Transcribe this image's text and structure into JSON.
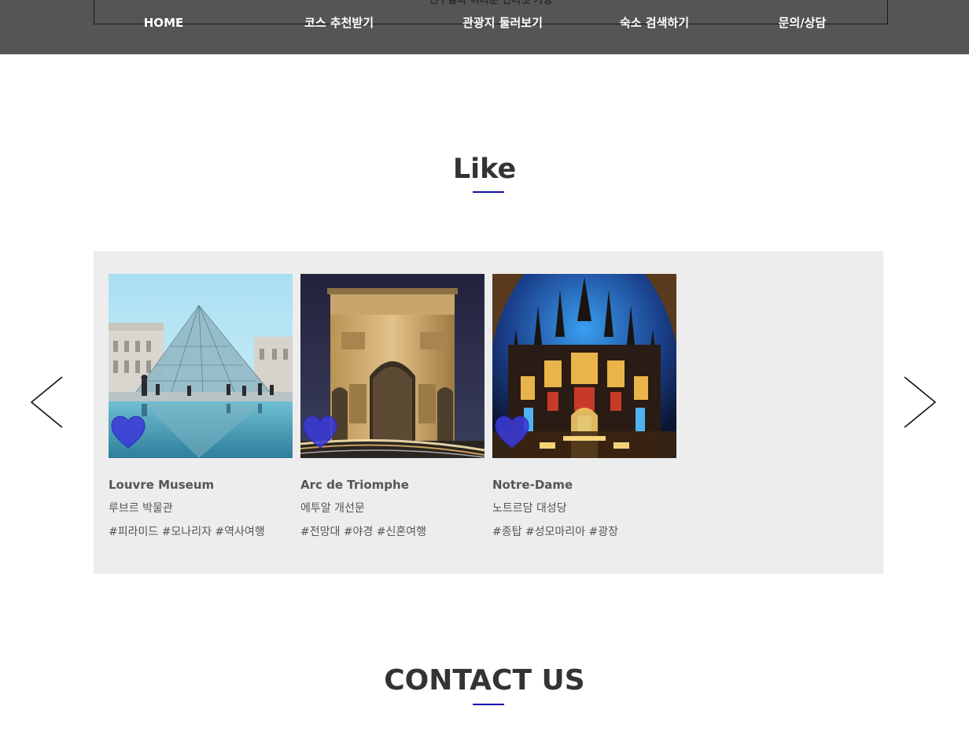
{
  "header": {
    "overflow_text": "친구들과 여러분 인터넷 가능",
    "nav": [
      {
        "label": "HOME"
      },
      {
        "label": "코스 추천받기"
      },
      {
        "label": "관광지 둘러보기"
      },
      {
        "label": "숙소 검색하기"
      },
      {
        "label": "문의/상담"
      }
    ]
  },
  "like_section": {
    "title": "Like",
    "cards": [
      {
        "name": "Louvre Museum",
        "korean_name": "루브르 박물관",
        "tags": "#피라미드 #모나리자 #역사여행",
        "image": "louvre-pyramid-photo"
      },
      {
        "name": "Arc de Triomphe",
        "korean_name": "에투알 개선문",
        "tags": "#전망대 #야경 #신혼여행",
        "image": "arc-de-triomphe-photo"
      },
      {
        "name": "Notre-Dame",
        "korean_name": "노트르담 대성당",
        "tags": "#종탑 #성모마리아 #광장",
        "image": "notre-dame-interior-photo"
      }
    ],
    "prev_icon": "chevron-left-icon",
    "next_icon": "chevron-right-icon",
    "heart_icon": "heart-icon"
  },
  "contact_section": {
    "title": "CONTACT US"
  },
  "colors": {
    "topbar": "#555555",
    "accent_underline": "#1212a8",
    "heart": "#3a3ad6",
    "panel": "#ededed"
  }
}
